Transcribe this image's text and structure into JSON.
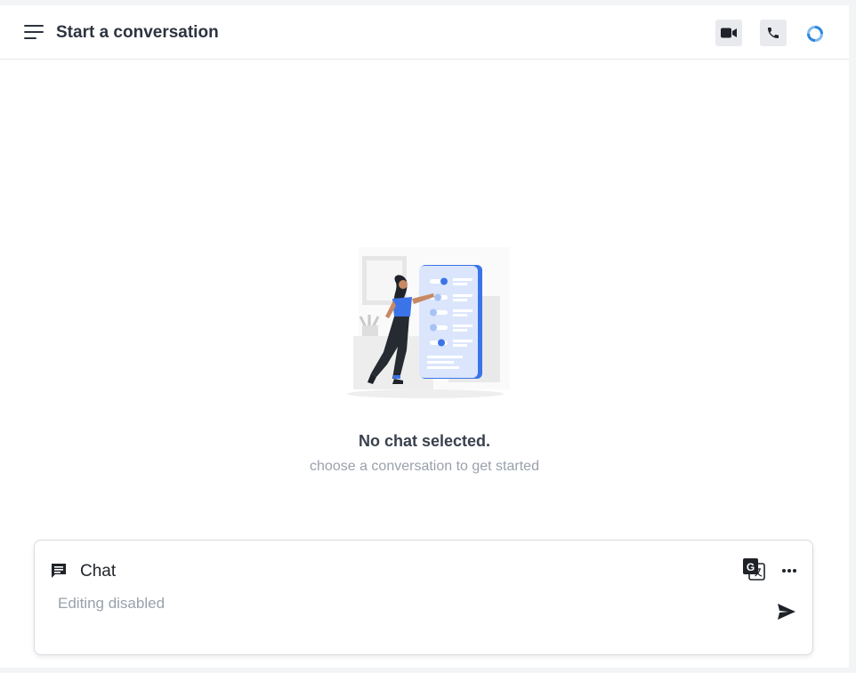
{
  "header": {
    "title": "Start a conversation",
    "icons": [
      "menu-icon",
      "video-camera-icon",
      "phone-icon",
      "status-ring-icon"
    ]
  },
  "empty_state": {
    "title": "No chat selected.",
    "subtitle": "choose a conversation to get started",
    "illustration": "person-selecting-chat-options-illustration"
  },
  "composer": {
    "mode_label": "Chat",
    "placeholder": "Editing disabled",
    "icons": [
      "chat-bubble-icon",
      "translate-icon",
      "more-horizontal-icon",
      "send-icon"
    ]
  },
  "colors": {
    "accent": "#4a7fe6",
    "title_text": "#2d3340",
    "muted_text": "#9aa1ab",
    "button_bg": "#e8eaed"
  }
}
